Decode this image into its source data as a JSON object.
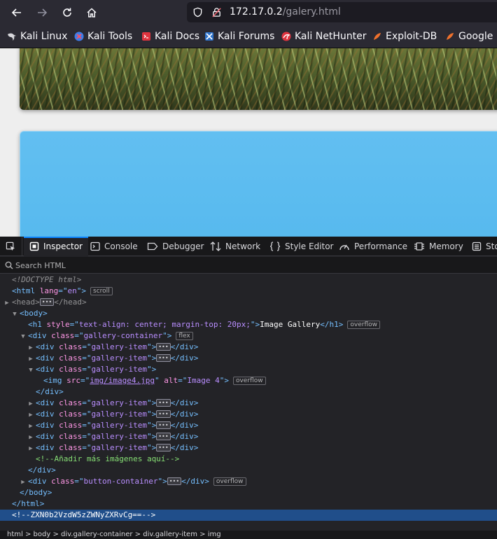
{
  "browser": {
    "url_host": "172.17.0.2",
    "url_path": "/galery.html"
  },
  "bookmarks": [
    {
      "label": "Kali Linux",
      "icon": "kali-dragon-icon"
    },
    {
      "label": "Kali Tools",
      "icon": "kali-tools-icon"
    },
    {
      "label": "Kali Docs",
      "icon": "kali-docs-icon"
    },
    {
      "label": "Kali Forums",
      "icon": "kali-forums-icon"
    },
    {
      "label": "Kali NetHunter",
      "icon": "kali-nethunter-icon"
    },
    {
      "label": "Exploit-DB",
      "icon": "exploit-db-icon"
    },
    {
      "label": "Google Hacking DB",
      "icon": "google-hacking-db-icon"
    }
  ],
  "devtools": {
    "tabs": [
      "Inspector",
      "Console",
      "Debugger",
      "Network",
      "Style Editor",
      "Performance",
      "Memory",
      "Storage"
    ],
    "active_tab": "Inspector",
    "search_placeholder": "Search HTML",
    "markup": {
      "doctype": "<!DOCTYPE html>",
      "html_lang": "en",
      "badge_scroll": "scroll",
      "badge_flex": "flex",
      "badge_overflow": "overflow",
      "h1_style": "text-align: center; margin-top: 20px;",
      "h1_text": "Image Gallery",
      "class_gallery_container": "gallery-container",
      "class_gallery_item": "gallery-item",
      "class_button_container": "button-container",
      "img_src": "img/image4.jpg",
      "img_alt": "Image 4",
      "comment_add": "<!--Añadir más imágenes aquí-->",
      "comment_selected": "<!--ZXN0b2VzdW5zZWNyZXRvCg==-->"
    },
    "breadcrumbs": [
      "html",
      "body",
      "div.gallery-container",
      "div.gallery-item",
      "img"
    ]
  },
  "colors": {
    "accent": "#0a84ff",
    "selection": "#204e8a",
    "tag": "#75bfff",
    "attr": "#ff97e6",
    "value": "#b98eff",
    "comment": "#86de74"
  }
}
